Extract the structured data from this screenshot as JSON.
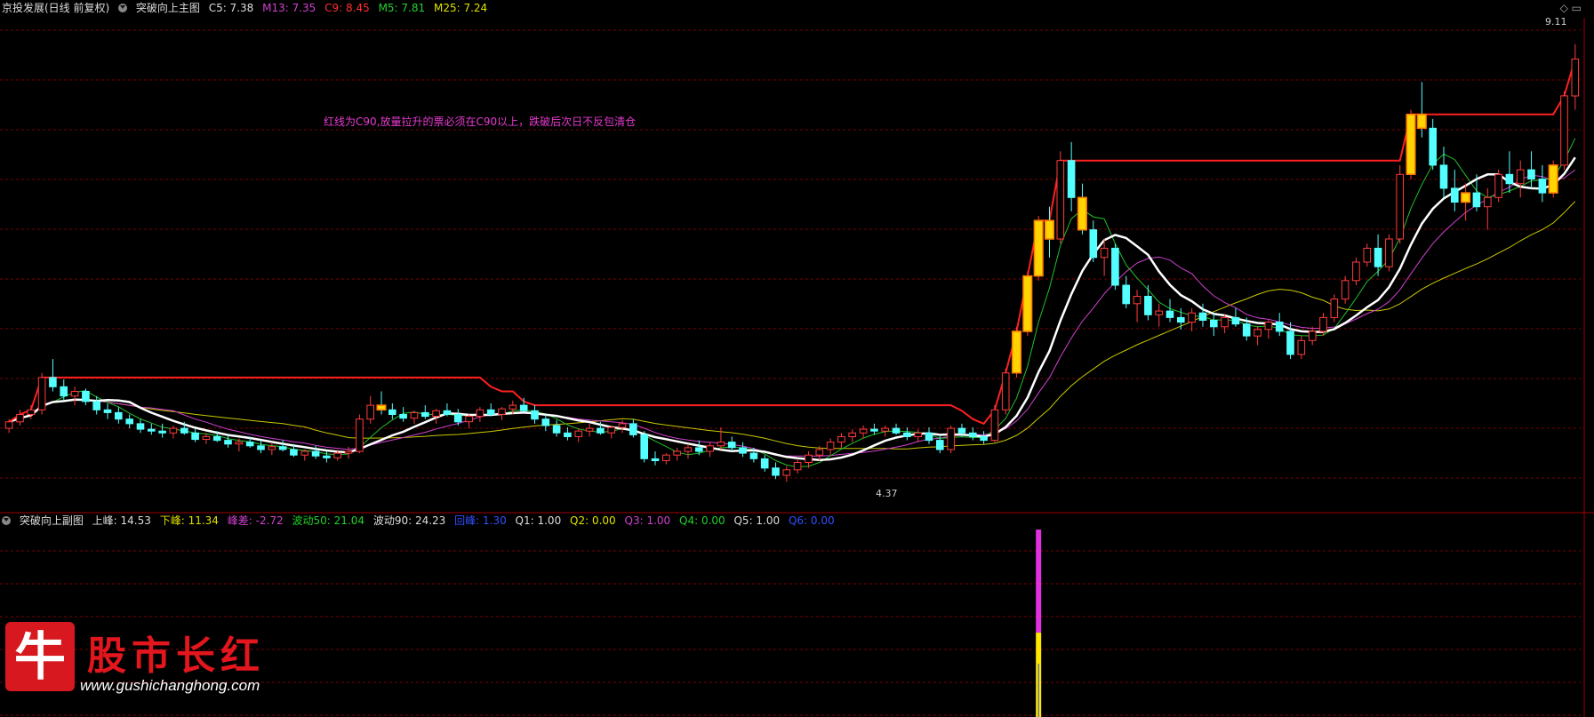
{
  "main_header": {
    "stock": "京投发展(日线 前复权)",
    "indicator": "突破向上主图",
    "c5": "C5: 7.38",
    "m13": "M13: 7.35",
    "c9": "C9: 8.45",
    "m5": "M5: 7.81",
    "m25": "M25: 7.24"
  },
  "sub_header": {
    "indicator": "突破向上副图",
    "upper": "上峰: 14.53",
    "lower": "下峰: 11.34",
    "diff": "峰差: -2.72",
    "wave50": "波动50: 21.04",
    "wave90": "波动90: 24.23",
    "back": "回峰: 1.30",
    "q1": "Q1: 1.00",
    "q2": "Q2: 0.00",
    "q3": "Q3: 1.00",
    "q4": "Q4: 0.00",
    "q5": "Q5: 1.00",
    "q6": "Q6: 0.00"
  },
  "annotation": "红线为C90,放量拉升的票必须在C90以上，跌破后次日不反包清仓",
  "labels": {
    "high": "9.11",
    "low": "4.37"
  },
  "logo": {
    "badge": "牛",
    "name": "股市长红",
    "url": "www.gushichanghong.com"
  },
  "colors": {
    "up": "#ff3b3b",
    "down": "#54ffff",
    "grid": "#7a0000",
    "c90": "#ff2020",
    "white_line": "#ffffff",
    "green_line": "#22c02a",
    "magenta_line": "#d040d0",
    "yellow_line": "#c8c800",
    "signal_bar": "#ffd400",
    "signal_edge": "#ff7a00"
  },
  "chart_data": {
    "type": "candlestick",
    "ylim": [
      4.2,
      9.3
    ],
    "candles": [
      [
        4.95,
        5.05,
        4.9,
        5.02
      ],
      [
        5.02,
        5.15,
        4.98,
        5.1
      ],
      [
        5.1,
        5.2,
        5.05,
        5.15
      ],
      [
        5.15,
        5.55,
        5.1,
        5.5
      ],
      [
        5.5,
        5.7,
        5.35,
        5.4
      ],
      [
        5.4,
        5.48,
        5.25,
        5.3
      ],
      [
        5.3,
        5.4,
        5.2,
        5.35
      ],
      [
        5.35,
        5.38,
        5.2,
        5.24
      ],
      [
        5.24,
        5.3,
        5.1,
        5.15
      ],
      [
        5.15,
        5.22,
        5.05,
        5.12
      ],
      [
        5.12,
        5.18,
        5.0,
        5.05
      ],
      [
        5.05,
        5.1,
        4.95,
        5.0
      ],
      [
        5.0,
        5.05,
        4.9,
        4.94
      ],
      [
        4.94,
        5.0,
        4.88,
        4.92
      ],
      [
        4.92,
        5.0,
        4.85,
        4.9
      ],
      [
        4.9,
        4.98,
        4.84,
        4.95
      ],
      [
        4.95,
        5.02,
        4.88,
        4.9
      ],
      [
        4.9,
        4.95,
        4.8,
        4.83
      ],
      [
        4.83,
        4.9,
        4.78,
        4.86
      ],
      [
        4.86,
        4.92,
        4.8,
        4.82
      ],
      [
        4.82,
        4.88,
        4.74,
        4.78
      ],
      [
        4.78,
        4.84,
        4.7,
        4.8
      ],
      [
        4.8,
        4.86,
        4.74,
        4.76
      ],
      [
        4.76,
        4.82,
        4.68,
        4.72
      ],
      [
        4.72,
        4.8,
        4.66,
        4.75
      ],
      [
        4.75,
        4.82,
        4.7,
        4.72
      ],
      [
        4.72,
        4.78,
        4.64,
        4.66
      ],
      [
        4.66,
        4.72,
        4.6,
        4.7
      ],
      [
        4.7,
        4.76,
        4.62,
        4.65
      ],
      [
        4.65,
        4.7,
        4.58,
        4.63
      ],
      [
        4.63,
        4.72,
        4.6,
        4.68
      ],
      [
        4.68,
        4.75,
        4.62,
        4.7
      ],
      [
        4.7,
        5.1,
        4.68,
        5.05
      ],
      [
        5.05,
        5.3,
        5.0,
        5.2
      ],
      [
        5.2,
        5.35,
        5.1,
        5.15
      ],
      [
        5.15,
        5.22,
        5.05,
        5.1
      ],
      [
        5.1,
        5.18,
        5.02,
        5.06
      ],
      [
        5.06,
        5.14,
        5.0,
        5.12
      ],
      [
        5.12,
        5.2,
        5.05,
        5.08
      ],
      [
        5.08,
        5.16,
        5.0,
        5.14
      ],
      [
        5.14,
        5.22,
        5.08,
        5.1
      ],
      [
        5.1,
        5.16,
        4.98,
        5.02
      ],
      [
        5.02,
        5.1,
        4.95,
        5.08
      ],
      [
        5.08,
        5.18,
        5.02,
        5.15
      ],
      [
        5.15,
        5.22,
        5.08,
        5.1
      ],
      [
        5.1,
        5.18,
        5.04,
        5.16
      ],
      [
        5.16,
        5.25,
        5.1,
        5.2
      ],
      [
        5.2,
        5.28,
        5.12,
        5.14
      ],
      [
        5.14,
        5.2,
        5.0,
        5.05
      ],
      [
        5.05,
        5.1,
        4.92,
        4.98
      ],
      [
        4.98,
        5.04,
        4.86,
        4.9
      ],
      [
        4.9,
        4.96,
        4.82,
        4.86
      ],
      [
        4.86,
        4.95,
        4.8,
        4.92
      ],
      [
        4.92,
        5.0,
        4.86,
        4.95
      ],
      [
        4.95,
        5.02,
        4.88,
        4.9
      ],
      [
        4.9,
        4.98,
        4.84,
        4.96
      ],
      [
        4.96,
        5.04,
        4.9,
        5.0
      ],
      [
        5.0,
        5.05,
        4.85,
        4.88
      ],
      [
        4.88,
        4.92,
        4.58,
        4.62
      ],
      [
        4.62,
        4.7,
        4.55,
        4.6
      ],
      [
        4.6,
        4.68,
        4.56,
        4.66
      ],
      [
        4.66,
        4.74,
        4.6,
        4.7
      ],
      [
        4.7,
        4.78,
        4.62,
        4.74
      ],
      [
        4.74,
        4.82,
        4.66,
        4.7
      ],
      [
        4.7,
        4.8,
        4.64,
        4.76
      ],
      [
        4.76,
        4.96,
        4.72,
        4.8
      ],
      [
        4.8,
        4.86,
        4.7,
        4.74
      ],
      [
        4.74,
        4.8,
        4.64,
        4.68
      ],
      [
        4.68,
        4.74,
        4.58,
        4.62
      ],
      [
        4.62,
        4.66,
        4.48,
        4.52
      ],
      [
        4.52,
        4.58,
        4.4,
        4.44
      ],
      [
        4.44,
        4.54,
        4.37,
        4.5
      ],
      [
        4.5,
        4.62,
        4.46,
        4.58
      ],
      [
        4.58,
        4.7,
        4.52,
        4.66
      ],
      [
        4.66,
        4.76,
        4.6,
        4.72
      ],
      [
        4.72,
        4.84,
        4.66,
        4.8
      ],
      [
        4.8,
        4.9,
        4.74,
        4.86
      ],
      [
        4.86,
        4.94,
        4.8,
        4.9
      ],
      [
        4.9,
        4.98,
        4.84,
        4.94
      ],
      [
        4.94,
        5.0,
        4.88,
        4.92
      ],
      [
        4.92,
        4.98,
        4.86,
        4.95
      ],
      [
        4.95,
        5.0,
        4.88,
        4.9
      ],
      [
        4.9,
        4.96,
        4.82,
        4.86
      ],
      [
        4.86,
        4.94,
        4.8,
        4.9
      ],
      [
        4.9,
        4.96,
        4.78,
        4.82
      ],
      [
        4.82,
        4.88,
        4.68,
        4.72
      ],
      [
        4.72,
        4.98,
        4.68,
        4.95
      ],
      [
        4.95,
        5.0,
        4.86,
        4.9
      ],
      [
        4.9,
        4.96,
        4.82,
        4.86
      ],
      [
        4.86,
        4.92,
        4.78,
        4.82
      ],
      [
        4.82,
        5.2,
        4.8,
        5.15
      ],
      [
        5.15,
        5.6,
        5.1,
        5.55
      ],
      [
        5.55,
        6.05,
        5.5,
        6.0
      ],
      [
        6.0,
        6.65,
        5.95,
        6.6
      ],
      [
        6.6,
        7.25,
        6.55,
        7.2
      ],
      [
        7.2,
        7.35,
        6.8,
        7.0
      ],
      [
        7.0,
        7.95,
        6.95,
        7.85
      ],
      [
        7.85,
        8.05,
        7.3,
        7.45
      ],
      [
        7.45,
        7.6,
        7.05,
        7.1
      ],
      [
        7.1,
        7.2,
        6.75,
        6.8
      ],
      [
        6.8,
        7.0,
        6.6,
        6.9
      ],
      [
        6.9,
        6.95,
        6.45,
        6.5
      ],
      [
        6.5,
        6.6,
        6.25,
        6.3
      ],
      [
        6.3,
        6.45,
        6.1,
        6.38
      ],
      [
        6.38,
        6.5,
        6.12,
        6.18
      ],
      [
        6.18,
        6.3,
        6.05,
        6.22
      ],
      [
        6.22,
        6.35,
        6.1,
        6.15
      ],
      [
        6.15,
        6.25,
        6.02,
        6.1
      ],
      [
        6.1,
        6.25,
        6.0,
        6.2
      ],
      [
        6.2,
        6.3,
        6.05,
        6.12
      ],
      [
        6.12,
        6.2,
        5.95,
        6.05
      ],
      [
        6.05,
        6.18,
        5.98,
        6.15
      ],
      [
        6.15,
        6.25,
        6.05,
        6.08
      ],
      [
        6.08,
        6.15,
        5.9,
        5.95
      ],
      [
        5.95,
        6.05,
        5.85,
        6.02
      ],
      [
        6.02,
        6.12,
        5.92,
        6.1
      ],
      [
        6.1,
        6.2,
        5.95,
        6.0
      ],
      [
        6.0,
        6.1,
        5.7,
        5.75
      ],
      [
        5.75,
        5.95,
        5.7,
        5.9
      ],
      [
        5.9,
        6.05,
        5.85,
        6.0
      ],
      [
        6.0,
        6.2,
        5.95,
        6.15
      ],
      [
        6.15,
        6.4,
        6.1,
        6.35
      ],
      [
        6.35,
        6.6,
        6.3,
        6.55
      ],
      [
        6.55,
        6.8,
        6.5,
        6.75
      ],
      [
        6.75,
        6.95,
        6.7,
        6.9
      ],
      [
        6.9,
        7.05,
        6.6,
        6.7
      ],
      [
        6.7,
        7.05,
        6.65,
        7.0
      ],
      [
        7.0,
        7.8,
        6.95,
        7.7
      ],
      [
        7.7,
        8.4,
        7.65,
        8.35
      ],
      [
        8.35,
        8.7,
        8.1,
        8.2
      ],
      [
        8.2,
        8.3,
        7.75,
        7.8
      ],
      [
        7.8,
        8.0,
        7.45,
        7.55
      ],
      [
        7.55,
        7.75,
        7.3,
        7.4
      ],
      [
        7.4,
        7.6,
        7.2,
        7.5
      ],
      [
        7.5,
        7.7,
        7.3,
        7.35
      ],
      [
        7.35,
        7.55,
        7.1,
        7.45
      ],
      [
        7.45,
        7.75,
        7.4,
        7.7
      ],
      [
        7.7,
        7.95,
        7.5,
        7.6
      ],
      [
        7.6,
        7.85,
        7.45,
        7.75
      ],
      [
        7.75,
        7.95,
        7.55,
        7.65
      ],
      [
        7.65,
        7.8,
        7.4,
        7.5
      ],
      [
        7.5,
        7.85,
        7.45,
        7.8
      ],
      [
        7.8,
        8.6,
        7.75,
        8.55
      ],
      [
        8.55,
        9.11,
        8.4,
        8.95
      ]
    ],
    "signals": [
      34,
      92,
      93,
      94,
      95,
      98,
      128,
      129,
      133,
      141
    ],
    "sub_panel": {
      "bar_index": 94,
      "segments": [
        {
          "from": 0,
          "to": 0.55,
          "color": "magenta"
        },
        {
          "from": 0.55,
          "to": 1.0,
          "color": "yellow"
        }
      ]
    }
  }
}
